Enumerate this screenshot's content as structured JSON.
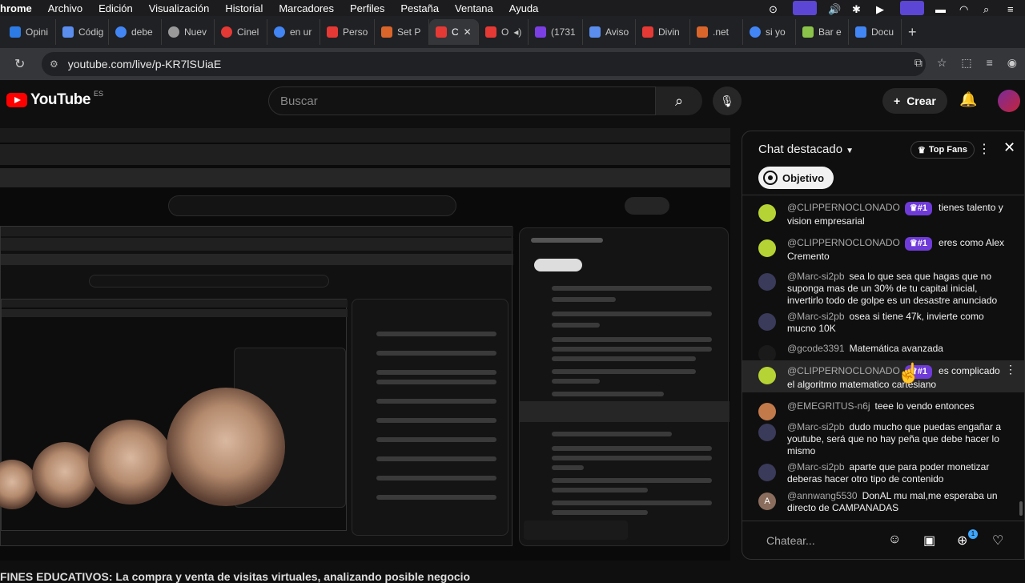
{
  "menubar": {
    "app": "hrome",
    "items": [
      "Archivo",
      "Edición",
      "Visualización",
      "Historial",
      "Marcadores",
      "Perfiles",
      "Pestaña",
      "Ventana",
      "Ayuda"
    ]
  },
  "tabs": [
    {
      "label": "Opini",
      "color": "#2d7be5"
    },
    {
      "label": "Códig",
      "color": "#5b8def"
    },
    {
      "label": "debe",
      "color": "#4285f4"
    },
    {
      "label": "Nuev",
      "color": "#999999"
    },
    {
      "label": "Cinel",
      "color": "#e53935"
    },
    {
      "label": "en ur",
      "color": "#4285f4"
    },
    {
      "label": "Perso",
      "color": "#e53935"
    },
    {
      "label": "Set P",
      "color": "#d9652b"
    },
    {
      "label": "C",
      "color": "#e53935",
      "active": true
    },
    {
      "label": "O",
      "color": "#e53935"
    },
    {
      "label": "(1731",
      "color": "#7b3fe4"
    },
    {
      "label": "Aviso",
      "color": "#5b8def"
    },
    {
      "label": "Divin",
      "color": "#e53935"
    },
    {
      "label": ".net",
      "color": "#d9652b"
    },
    {
      "label": "si yo",
      "color": "#4285f4"
    },
    {
      "label": "Bar e",
      "color": "#8bc34a"
    },
    {
      "label": "Docu",
      "color": "#4285f4"
    }
  ],
  "address": {
    "url": "youtube.com/live/p-KR7lSUiaE"
  },
  "youtube": {
    "logo": "YouTube",
    "country": "ES",
    "search_placeholder": "Buscar",
    "create_label": "Crear"
  },
  "chat": {
    "title": "Chat destacado",
    "top_fans": "Top Fans",
    "objective": "Objetivo",
    "input_placeholder": "Chatear...",
    "notif_count": "1",
    "messages": [
      {
        "author": "@CLIPPERNOCLONADO",
        "badge": "#1",
        "text": "tienes talento y vision empresarial",
        "avatar": "#b5d334"
      },
      {
        "author": "@CLIPPERNOCLONADO",
        "badge": "#1",
        "text": "eres como Alex Cremento",
        "avatar": "#b5d334"
      },
      {
        "author": "@Marc-si2pb",
        "badge": "",
        "text": "sea lo que sea que hagas que no suponga mas de un 30% de tu capital inicial, invertirlo todo de golpe es un desastre anunciado",
        "avatar": "#3a3a5a"
      },
      {
        "author": "@Marc-si2pb",
        "badge": "",
        "text": "osea si tiene 47k, invierte como mucno 10K",
        "avatar": "#3a3a5a"
      },
      {
        "author": "@gcode3391",
        "badge": "",
        "text": "Matemática avanzada",
        "avatar": "#1a1a1a"
      },
      {
        "author": "@CLIPPERNOCLONADO",
        "badge": "#1",
        "text": "es complicado el algoritmo matematico cartesiano",
        "avatar": "#b5d334",
        "highlight": true
      },
      {
        "author": "@EMEGRITUS-n6j",
        "badge": "",
        "text": "teee lo vendo entonces",
        "avatar": "#c27a4a"
      },
      {
        "author": "@Marc-si2pb",
        "badge": "",
        "text": "dudo mucho que puedas engañar a youtube, será que no hay peña que debe hacer lo mismo",
        "avatar": "#3a3a5a"
      },
      {
        "author": "@Marc-si2pb",
        "badge": "",
        "text": "aparte que para poder monetizar deberas hacer otro tipo de contenido",
        "avatar": "#3a3a5a"
      },
      {
        "author": "@annwang5530",
        "badge": "",
        "text": "DonAL mu mal,me esperaba un directo de CAMPANADAS",
        "avatar": "#8a6d5c",
        "initial": "A"
      }
    ]
  },
  "caption": "FINES EDUCATIVOS: La compra y venta de visitas virtuales, analizando posible negocio"
}
